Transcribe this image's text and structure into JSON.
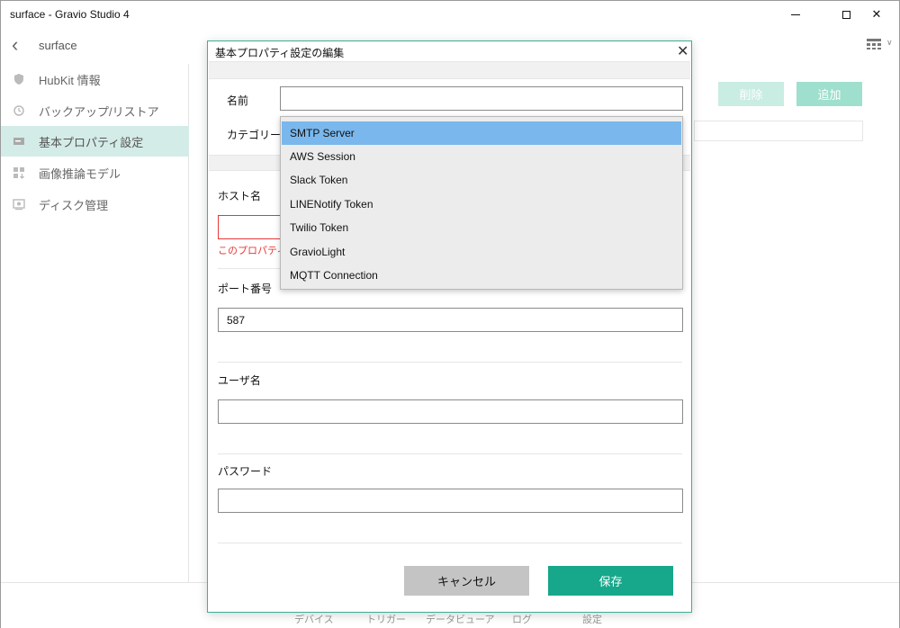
{
  "window": {
    "title": "surface - Gravio Studio 4"
  },
  "appbar": {
    "crumb": "surface"
  },
  "sidebar": {
    "items": [
      {
        "label": "HubKit 情報"
      },
      {
        "label": "バックアップ/リストア"
      },
      {
        "label": "基本プロパティ設定"
      },
      {
        "label": "画像推論モデル"
      },
      {
        "label": "ディスク管理"
      }
    ],
    "active_index": 2
  },
  "main": {
    "delete_label": "削除",
    "add_label": "追加"
  },
  "bottom_nav": [
    "デバイス",
    "トリガー",
    "データビューア",
    "ログ",
    "設定"
  ],
  "dialog": {
    "title": "基本プロパティ設定の編集",
    "name_label": "名前",
    "name_value": "",
    "category_label": "カテゴリー",
    "host_label": "ホスト名",
    "host_value": "",
    "host_error": "このプロパティは",
    "port_label": "ポート番号",
    "port_value": "587",
    "user_label": "ユーザ名",
    "user_value": "",
    "password_label": "パスワード",
    "password_value": "",
    "cancel_label": "キャンセル",
    "save_label": "保存"
  },
  "category_dropdown": {
    "selected": "SMTP Server",
    "options": [
      "SMTP Server",
      "AWS Session",
      "Slack Token",
      "LINENotify Token",
      "Twilio Token",
      "GravioLight",
      "MQTT Connection"
    ]
  },
  "colors": {
    "accent": "#17a78a",
    "active_sidebar": "#d4ece7",
    "selected_option": "#7ab7ec",
    "error": "#e53935"
  }
}
